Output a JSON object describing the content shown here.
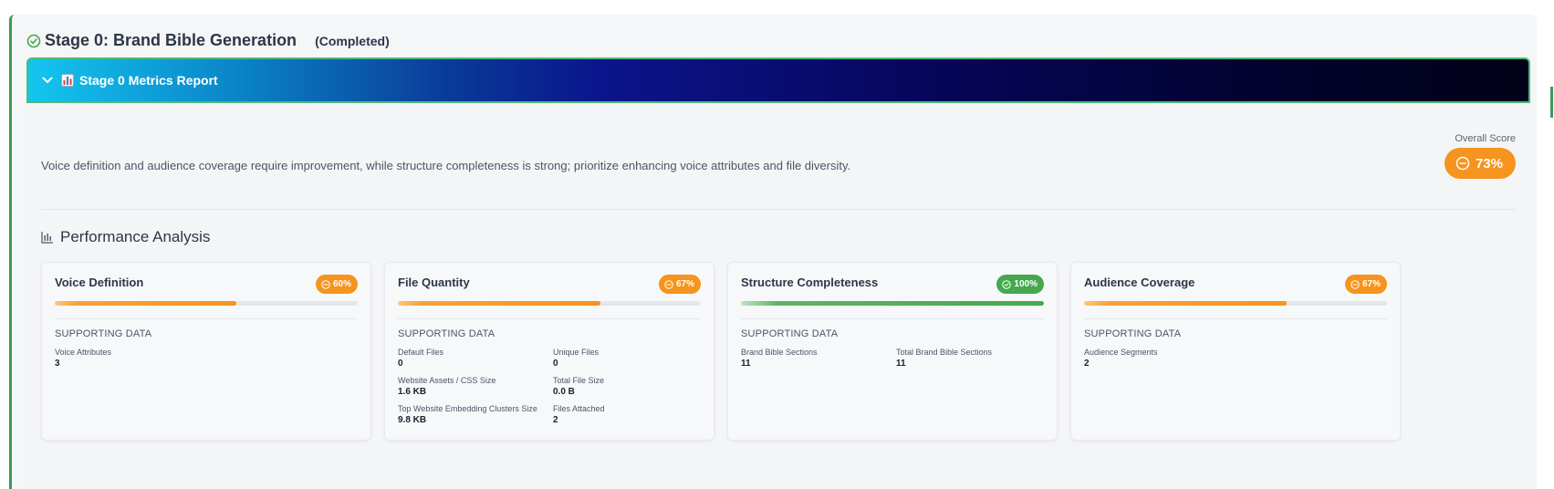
{
  "stage": {
    "title": "Stage 0: Brand Bible Generation",
    "status": "(Completed)"
  },
  "metrics_report": {
    "label": "Stage 0 Metrics Report",
    "summary": "Voice definition and audience coverage require improvement, while structure completeness is strong; prioritize enhancing voice attributes and file diversity.",
    "overall_score_label": "Overall Score",
    "overall_score": "73%",
    "overall_score_status": "warning"
  },
  "performance": {
    "title": "Performance Analysis",
    "supporting_label": "SUPPORTING DATA",
    "cards": [
      {
        "title": "Voice Definition",
        "score": "60%",
        "progress": 0.6,
        "status": "warning",
        "data": [
          {
            "name": "Voice Attributes",
            "value": "3"
          }
        ]
      },
      {
        "title": "File Quantity",
        "score": "67%",
        "progress": 0.67,
        "status": "warning",
        "data": [
          {
            "name": "Default Files",
            "value": "0"
          },
          {
            "name": "Unique Files",
            "value": "0"
          },
          {
            "name": "Website Assets / CSS Size",
            "value": "1.6 KB"
          },
          {
            "name": "Total File Size",
            "value": "0.0 B"
          },
          {
            "name": "Top Website Embedding Clusters Size",
            "value": "9.8 KB"
          },
          {
            "name": "Files Attached",
            "value": "2"
          }
        ]
      },
      {
        "title": "Structure Completeness",
        "score": "100%",
        "progress": 1.0,
        "status": "ok",
        "data": [
          {
            "name": "Brand Bible Sections",
            "value": "11"
          },
          {
            "name": "Total Brand Bible Sections",
            "value": "11"
          }
        ]
      },
      {
        "title": "Audience Coverage",
        "score": "67%",
        "progress": 0.67,
        "status": "warning",
        "data": [
          {
            "name": "Audience Segments",
            "value": "2"
          }
        ]
      }
    ]
  },
  "colors": {
    "warning": "#f5941e",
    "ok": "#45a84f",
    "accent_border": "#3a9a5b"
  },
  "icons": {
    "stage": "check-circle-icon",
    "banner_toggle": "chevron-down-icon",
    "banner_emoji": "bar-chart-emoji-icon",
    "performance": "bar-chart-icon",
    "warning_badge": "minus-circle-icon",
    "ok_badge": "check-circle-icon"
  }
}
